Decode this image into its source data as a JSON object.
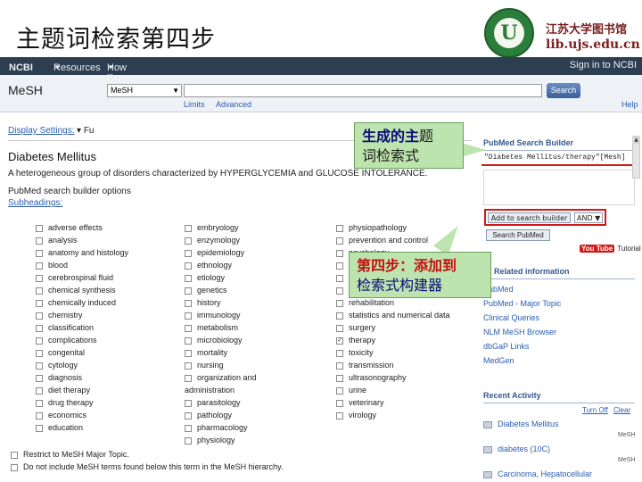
{
  "slide": {
    "title": "主题词检索第四步",
    "library_name": "江苏大学图书馆",
    "library_url": "lib.ujs.edu.cn",
    "logo_glyph": "U"
  },
  "ncbi_bar": {
    "logo": "NCBI",
    "resources": "Resources",
    "how_to": "How To",
    "sign_in": "Sign in to NCBI"
  },
  "search": {
    "db_label": "MeSH",
    "db_value": "MeSH",
    "query": "",
    "search_button": "Search",
    "limits": "Limits",
    "advanced": "Advanced",
    "help": "Help"
  },
  "record": {
    "display_settings": "Display Settings:",
    "display_value": "Fu",
    "title": "Diabetes Mellitus",
    "definition": "A heterogeneous group of disorders characterized by HYPERGLYCEMIA and GLUCOSE INTOLERANCE.",
    "builder_options": "PubMed search builder options",
    "subheadings": "Subheadings:"
  },
  "subheadings": {
    "col1": [
      "adverse effects",
      "analysis",
      "anatomy and histology",
      "blood",
      "cerebrospinal fluid",
      "chemical synthesis",
      "chemically induced",
      "chemistry",
      "classification",
      "complications",
      "congenital",
      "cytology",
      "diagnosis",
      "diet therapy",
      "drug therapy",
      "economics",
      "education"
    ],
    "col2": [
      "embryology",
      "enzymology",
      "epidemiology",
      "ethnology",
      "etiology",
      "genetics",
      "history",
      "immunology",
      "metabolism",
      "microbiology",
      "mortality",
      "nursing",
      "organization and",
      "administration",
      "parasitology",
      "pathology",
      "pharmacology",
      "physiology"
    ],
    "col3": [
      "physiopathology",
      "prevention and control",
      "psychology",
      "radiography",
      "radionuclide imaging",
      "radiotherapy",
      "rehabilitation",
      "statistics and numerical data",
      "surgery",
      "therapy",
      "toxicity",
      "transmission",
      "ultrasonography",
      "urine",
      "veterinary",
      "virology"
    ],
    "checked_col3": "therapy"
  },
  "options": {
    "restrict": "Restrict to MeSH Major Topic.",
    "no_include": "Do not include MeSH terms found below this term in the MeSH hierarchy."
  },
  "builder": {
    "title": "PubMed Search Builder",
    "query": "\"Diabetes Mellitus/therapy\"[Mesh]",
    "add_button": "Add to search builder",
    "and_value": "AND",
    "search_pubmed": "Search PubMed",
    "youtube": "You Tube",
    "tutorial": "Tutorial"
  },
  "related": {
    "title": "Related information",
    "items": [
      "PubMed",
      "PubMed - Major Topic",
      "Clinical Queries",
      "NLM MeSH Browser",
      "dbGaP Links",
      "MedGen"
    ]
  },
  "recent": {
    "title": "Recent Activity",
    "turn_off": "Turn Off",
    "clear": "Clear",
    "items": [
      {
        "label": "Diabetes Mellitus",
        "sub": "MeSH"
      },
      {
        "label": "diabetes (10C)",
        "sub": "MeSH"
      },
      {
        "label": "Carcinoma, Hepatocellular",
        "sub": "MeSH"
      }
    ]
  },
  "callouts": {
    "c1_line1_hl": "生成的主",
    "c1_line1_rest": "题",
    "c1_line2": "词检索式",
    "c2_line1": "第四步：添加到",
    "c2_line2": "检索式构建器"
  }
}
